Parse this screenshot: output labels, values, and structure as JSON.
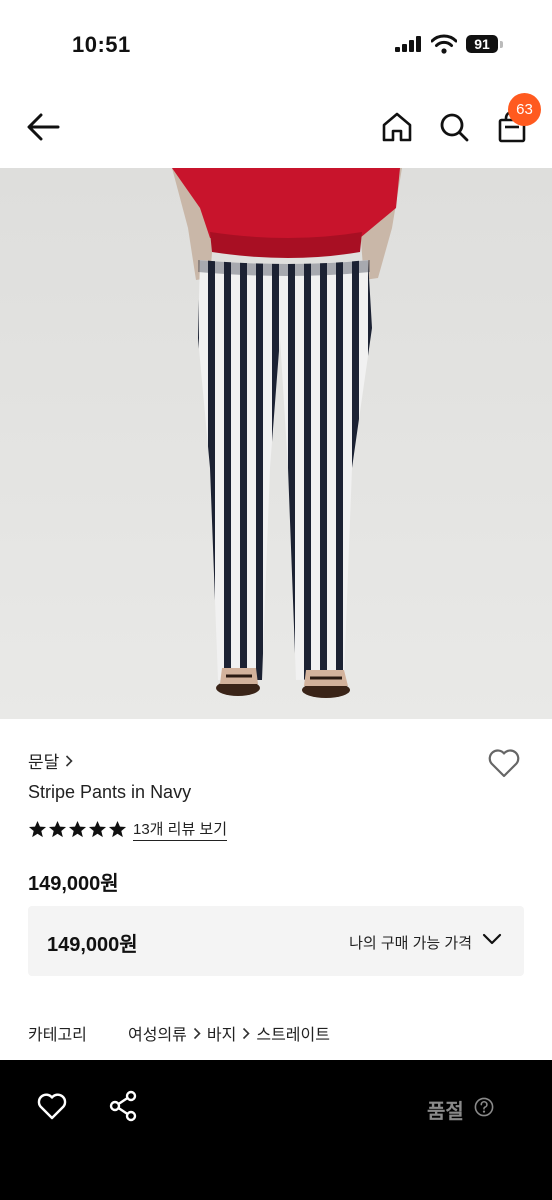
{
  "status_bar": {
    "time": "10:51",
    "battery": "91"
  },
  "header": {
    "cart_count": "63",
    "icons": [
      "back-arrow-icon",
      "home-icon",
      "search-icon",
      "shopping-bag-icon"
    ]
  },
  "product": {
    "brand": "문달",
    "name": "Stripe Pants in Navy",
    "rating_stars": 5,
    "review_link": "13개 리뷰 보기",
    "price": "149,000원",
    "my_price": {
      "value": "149,000원",
      "label": "나의 구매 가능 가격"
    },
    "category": {
      "label": "카테고리",
      "path": [
        "여성의류",
        "바지",
        "스트레이트"
      ]
    }
  },
  "bottom_bar": {
    "status": "품절",
    "icons": [
      "heart-icon",
      "share-icon",
      "help-icon"
    ]
  },
  "colors": {
    "badge": "#ff5a1f",
    "bottom_bar": "#000000",
    "price_box": "#f4f4f4",
    "soldout_text": "#8a8a8a"
  }
}
